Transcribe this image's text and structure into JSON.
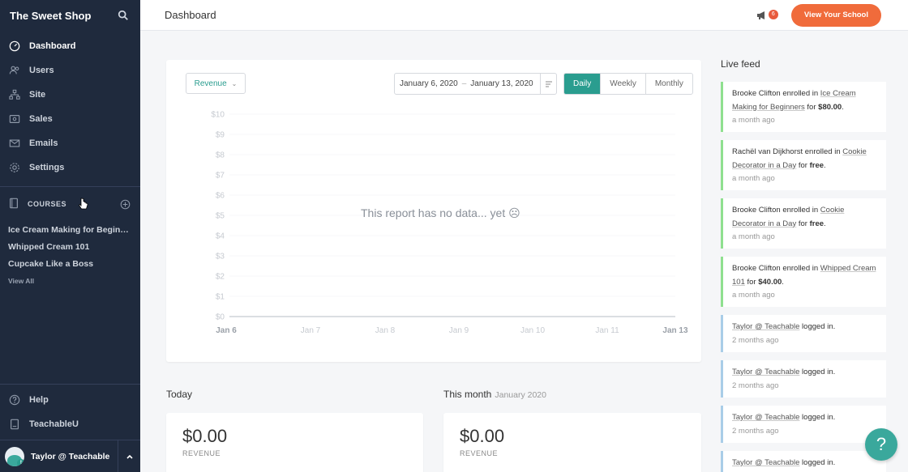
{
  "sidebar": {
    "school_name": "The Sweet Shop",
    "nav": [
      {
        "label": "Dashboard",
        "icon": "dashboard-icon",
        "active": true
      },
      {
        "label": "Users",
        "icon": "users-icon"
      },
      {
        "label": "Site",
        "icon": "site-icon"
      },
      {
        "label": "Sales",
        "icon": "sales-icon"
      },
      {
        "label": "Emails",
        "icon": "emails-icon"
      },
      {
        "label": "Settings",
        "icon": "gear-icon"
      }
    ],
    "courses_label": "COURSES",
    "courses": [
      "Ice Cream Making for Beginners",
      "Whipped Cream 101",
      "Cupcake Like a Boss"
    ],
    "view_all": "View All",
    "bottom": [
      {
        "label": "Help",
        "icon": "help-icon"
      },
      {
        "label": "TeachableU",
        "icon": "teachableu-icon"
      }
    ],
    "user_name": "Taylor @ Teachable"
  },
  "topbar": {
    "title": "Dashboard",
    "notification_count": "6",
    "view_school_label": "View Your School"
  },
  "controls": {
    "metric": "Revenue",
    "date_from": "January 6, 2020",
    "date_sep": "–",
    "date_to": "January 13, 2020",
    "periods": [
      {
        "label": "Daily",
        "active": true
      },
      {
        "label": "Weekly"
      },
      {
        "label": "Monthly"
      }
    ]
  },
  "chart_data": {
    "type": "line",
    "x": [
      "Jan 6",
      "Jan 7",
      "Jan 8",
      "Jan 9",
      "Jan 10",
      "Jan 11",
      "Jan 13"
    ],
    "y_ticks": [
      "$10",
      "$9",
      "$8",
      "$7",
      "$6",
      "$5",
      "$4",
      "$3",
      "$2",
      "$1",
      "$0"
    ],
    "ylim": [
      0,
      10
    ],
    "series": [],
    "annotation": "This report has no data... yet ☹"
  },
  "stats": {
    "today": {
      "heading": "Today",
      "value": "$0.00",
      "label": "REVENUE"
    },
    "month": {
      "heading": "This month",
      "sub": "January 2020",
      "value": "$0.00",
      "label": "REVENUE"
    }
  },
  "live_feed": {
    "title": "Live feed",
    "items": [
      {
        "type": "enroll",
        "user": "Brooke Clifton",
        "action": "enrolled in",
        "course": "Ice Cream Making for Beginners",
        "suffix_pre": "for",
        "amount": "$80.00",
        "time": "a month ago"
      },
      {
        "type": "enroll",
        "user": "Rachël van Dijkhorst",
        "action": "enrolled in",
        "course": "Cookie Decorator in a Day",
        "suffix_pre": "for",
        "amount": "free",
        "time": "a month ago"
      },
      {
        "type": "enroll",
        "user": "Brooke Clifton",
        "action": "enrolled in",
        "course": "Cookie Decorator in a Day",
        "suffix_pre": "for",
        "amount": "free",
        "time": "a month ago"
      },
      {
        "type": "enroll",
        "user": "Brooke Clifton",
        "action": "enrolled in",
        "course": "Whipped Cream 101",
        "suffix_pre": "for",
        "amount": "$40.00",
        "time": "a month ago"
      },
      {
        "type": "login",
        "user": "Taylor @ Teachable",
        "action": "logged in.",
        "time": "2 months ago"
      },
      {
        "type": "login",
        "user": "Taylor @ Teachable",
        "action": "logged in.",
        "time": "2 months ago"
      },
      {
        "type": "login",
        "user": "Taylor @ Teachable",
        "action": "logged in.",
        "time": "2 months ago"
      },
      {
        "type": "login",
        "user": "Taylor @ Teachable",
        "action": "logged in.",
        "time": ""
      }
    ]
  },
  "help_fab": "?"
}
